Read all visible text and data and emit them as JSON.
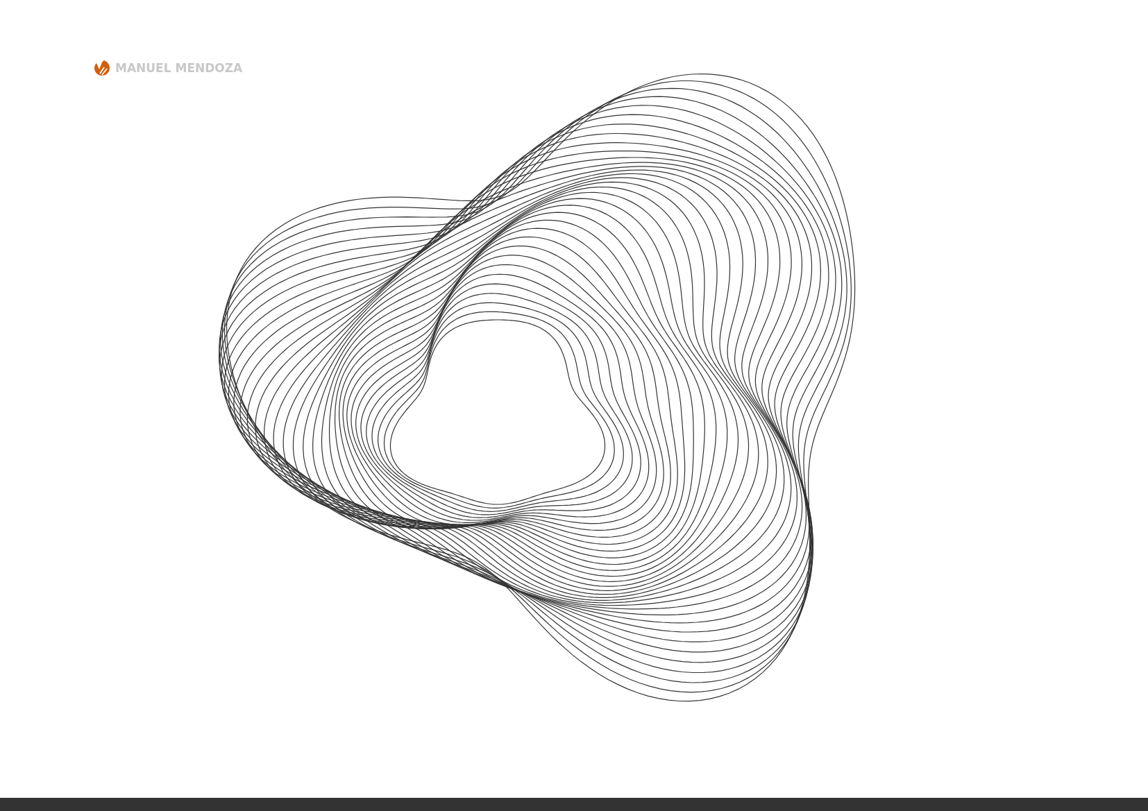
{
  "brand": {
    "name": "MANUEL MENDOZA"
  }
}
